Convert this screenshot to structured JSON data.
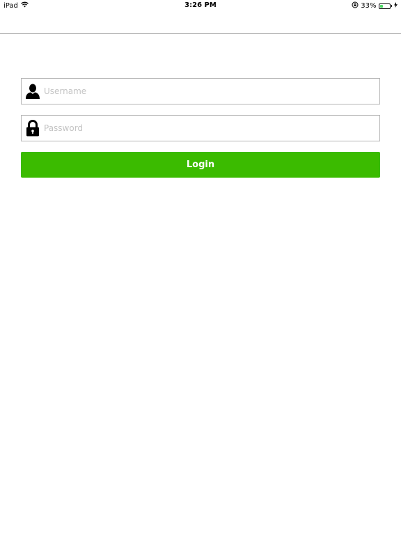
{
  "status_bar": {
    "device": "iPad",
    "time": "3:26 PM",
    "battery_percent_label": "33%",
    "battery_level": 0.33,
    "icons": [
      "wifi-icon",
      "rotation-lock-icon",
      "battery-icon",
      "charging-bolt-icon"
    ]
  },
  "login_form": {
    "username": {
      "value": "",
      "placeholder": "Username",
      "icon": "user-icon"
    },
    "password": {
      "value": "",
      "placeholder": "Password",
      "icon": "lock-icon"
    },
    "login_label": "Login"
  },
  "colors": {
    "accent": "#3bbb00",
    "field_border": "#b5b5b5",
    "nav_divider": "#9a9a9a",
    "battery_fill": "#4cd964"
  }
}
